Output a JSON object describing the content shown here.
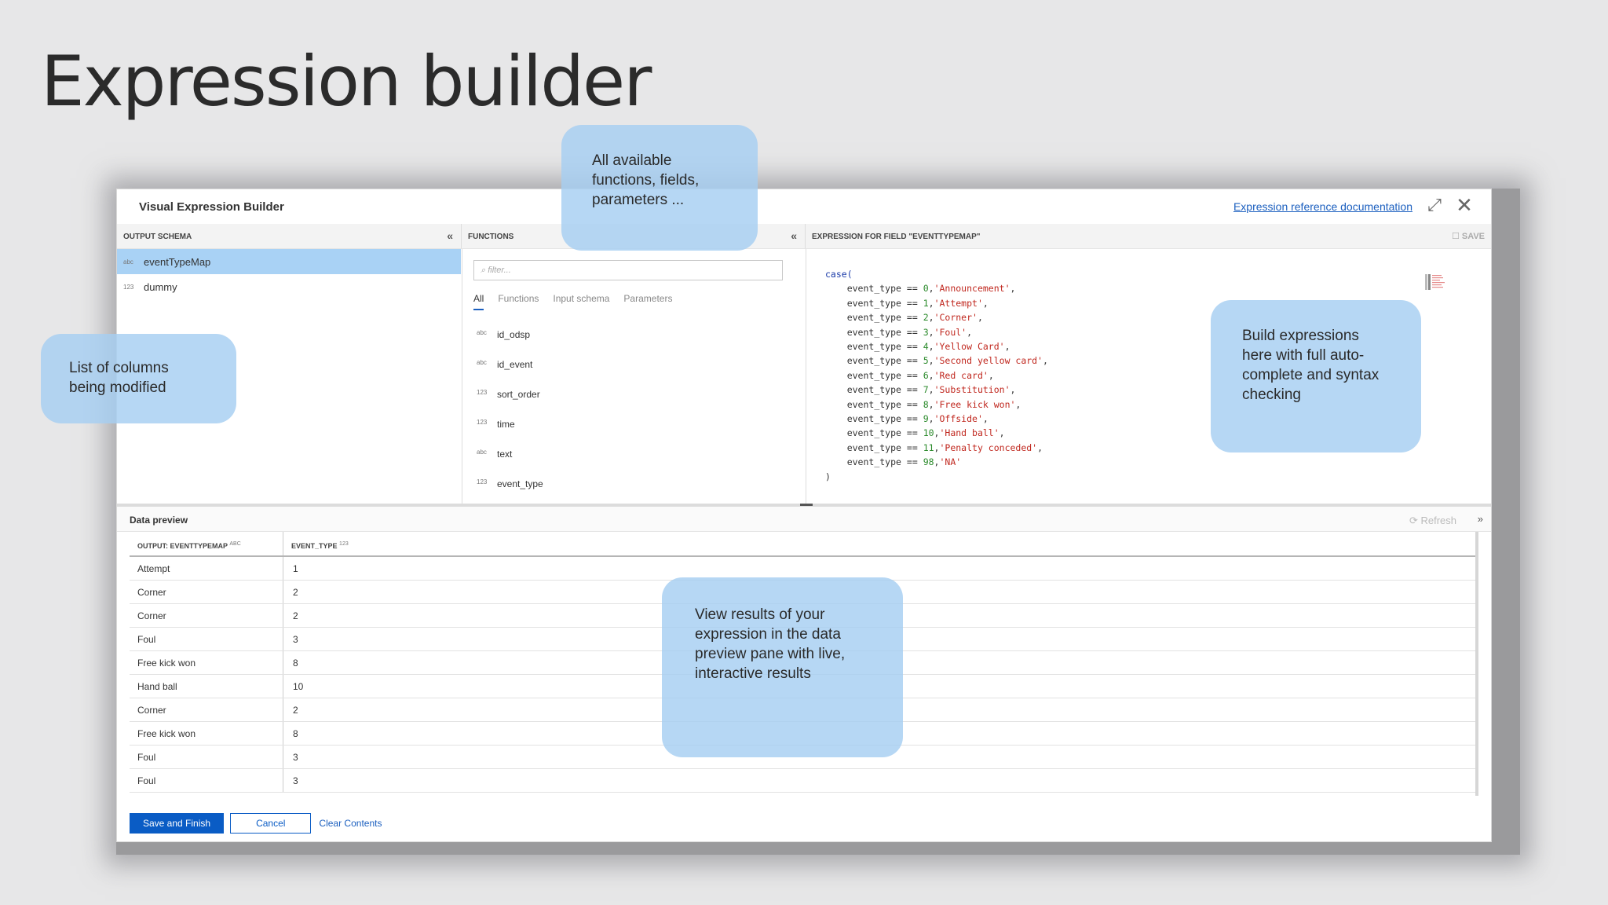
{
  "slide": {
    "title": "Expression builder"
  },
  "dialog": {
    "title": "Visual Expression Builder",
    "doc_link": "Expression reference documentation",
    "expand_glyph": "⤢",
    "close_glyph": "✕"
  },
  "schema": {
    "header": "OUTPUT SCHEMA",
    "collapse_glyph": "«",
    "items": [
      {
        "type": "abc",
        "label": "eventTypeMap",
        "selected": true
      },
      {
        "type": "123",
        "label": "dummy",
        "selected": false
      }
    ]
  },
  "functions": {
    "header": "FUNCTIONS",
    "collapse_glyph": "«",
    "filter_placeholder": "⌕ filter...",
    "tabs": [
      "All",
      "Functions",
      "Input schema",
      "Parameters"
    ],
    "active_tab": "All",
    "items": [
      {
        "type": "abc",
        "label": "id_odsp"
      },
      {
        "type": "abc",
        "label": "id_event"
      },
      {
        "type": "123",
        "label": "sort_order"
      },
      {
        "type": "123",
        "label": "time"
      },
      {
        "type": "abc",
        "label": "text"
      },
      {
        "type": "123",
        "label": "event_type"
      }
    ]
  },
  "expression": {
    "header": "EXPRESSION FOR FIELD \"EVENTTYPEMAP\"",
    "save_label": "☐ Save",
    "open": "case(",
    "close": ")",
    "lines": [
      {
        "field": "event_type",
        "op": "==",
        "num": "0",
        "str": "'Announcement'",
        "sep": ","
      },
      {
        "field": "event_type",
        "op": "==",
        "num": "1",
        "str": "'Attempt'",
        "sep": ","
      },
      {
        "field": "event_type",
        "op": "==",
        "num": "2",
        "str": "'Corner'",
        "sep": ","
      },
      {
        "field": "event_type",
        "op": "==",
        "num": "3",
        "str": "'Foul'",
        "sep": ","
      },
      {
        "field": "event_type",
        "op": "==",
        "num": "4",
        "str": "'Yellow Card'",
        "sep": ","
      },
      {
        "field": "event_type",
        "op": "==",
        "num": "5",
        "str": "'Second yellow card'",
        "sep": ","
      },
      {
        "field": "event_type",
        "op": "==",
        "num": "6",
        "str": "'Red card'",
        "sep": ","
      },
      {
        "field": "event_type",
        "op": "==",
        "num": "7",
        "str": "'Substitution'",
        "sep": ","
      },
      {
        "field": "event_type",
        "op": "==",
        "num": "8",
        "str": "'Free kick won'",
        "sep": ","
      },
      {
        "field": "event_type",
        "op": "==",
        "num": "9",
        "str": "'Offside'",
        "sep": ","
      },
      {
        "field": "event_type",
        "op": "==",
        "num": "10",
        "str": "'Hand ball'",
        "sep": ","
      },
      {
        "field": "event_type",
        "op": "==",
        "num": "11",
        "str": "'Penalty conceded'",
        "sep": ","
      },
      {
        "field": "event_type",
        "op": "==",
        "num": "98",
        "str": "'NA'",
        "sep": ""
      }
    ]
  },
  "data_preview": {
    "title": "Data preview",
    "refresh_label": "⟳ Refresh",
    "collapse_glyph": "»",
    "columns": [
      {
        "label": "OUTPUT: EVENTTYPEMAP",
        "type": "abc"
      },
      {
        "label": "EVENT_TYPE",
        "type": "123"
      }
    ],
    "rows": [
      [
        "Attempt",
        "1"
      ],
      [
        "Corner",
        "2"
      ],
      [
        "Corner",
        "2"
      ],
      [
        "Foul",
        "3"
      ],
      [
        "Free kick won",
        "8"
      ],
      [
        "Hand ball",
        "10"
      ],
      [
        "Corner",
        "2"
      ],
      [
        "Free kick won",
        "8"
      ],
      [
        "Foul",
        "3"
      ],
      [
        "Foul",
        "3"
      ]
    ]
  },
  "footer": {
    "save_finish": "Save and Finish",
    "cancel": "Cancel",
    "clear": "Clear Contents"
  },
  "callouts": {
    "functions": "All available functions, fields, parameters ...",
    "columns": "List of columns being modified",
    "build": "Build expressions here with full auto-complete and syntax checking",
    "results": "View results of your expression in the data preview pane with live, interactive results"
  },
  "colors": {
    "accent": "#0a5cc5",
    "selected_row": "#a9d2f5",
    "callout": "#a6cef1",
    "code_keyword": "#1a3aa8",
    "code_number": "#2b8a2b",
    "code_string": "#c0271e"
  }
}
